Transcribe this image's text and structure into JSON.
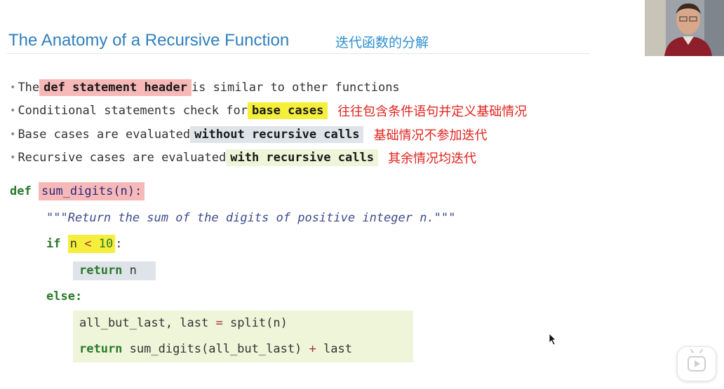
{
  "slide": {
    "title": "The Anatomy of a Recursive Function",
    "title_note": "迭代函数的分解"
  },
  "bullets": [
    {
      "pre": "The ",
      "highlight": "def statement header",
      "post": " is similar to other functions",
      "note": ""
    },
    {
      "pre": "Conditional statements check for ",
      "highlight": "base cases",
      "post": "",
      "note": "往往包含条件语句并定义基础情况"
    },
    {
      "pre": "Base cases are evaluated ",
      "highlight": "without recursive calls",
      "post": "",
      "note": "基础情况不参加迭代"
    },
    {
      "pre": "Recursive cases are evaluated ",
      "highlight": "with recursive calls",
      "post": "",
      "note": "其余情况均迭代"
    }
  ],
  "code": {
    "def_kw": "def",
    "signature": "sum_digits(n):",
    "docstring": "\"\"\"Return the sum of the digits of positive integer n.\"\"\"",
    "if_kw": "if",
    "cond_var": "n",
    "cond_op": "<",
    "cond_num": "10",
    "colon": ":",
    "return_kw": "return",
    "return_val": "n",
    "else_kw": "else:",
    "line_split_lhs": "all_but_last, last ",
    "line_split_eq": "=",
    "line_split_rhs": " split(n)",
    "return2_kw": "return",
    "return2_call": " sum_digits(all_but_last) ",
    "return2_op": "+",
    "return2_tail": " last"
  },
  "colors": {
    "title": "#2f7fbd",
    "note_red": "#e0231c",
    "highlight_pink": "#f7b8b8",
    "highlight_yellow": "#f5ee3a",
    "highlight_gray": "#dfe3ea",
    "highlight_green": "#eef5d9",
    "keyword_green": "#2a7a2a"
  },
  "overlay": {
    "webcam": "presenter-webcam",
    "play_icon": "play-icon"
  }
}
